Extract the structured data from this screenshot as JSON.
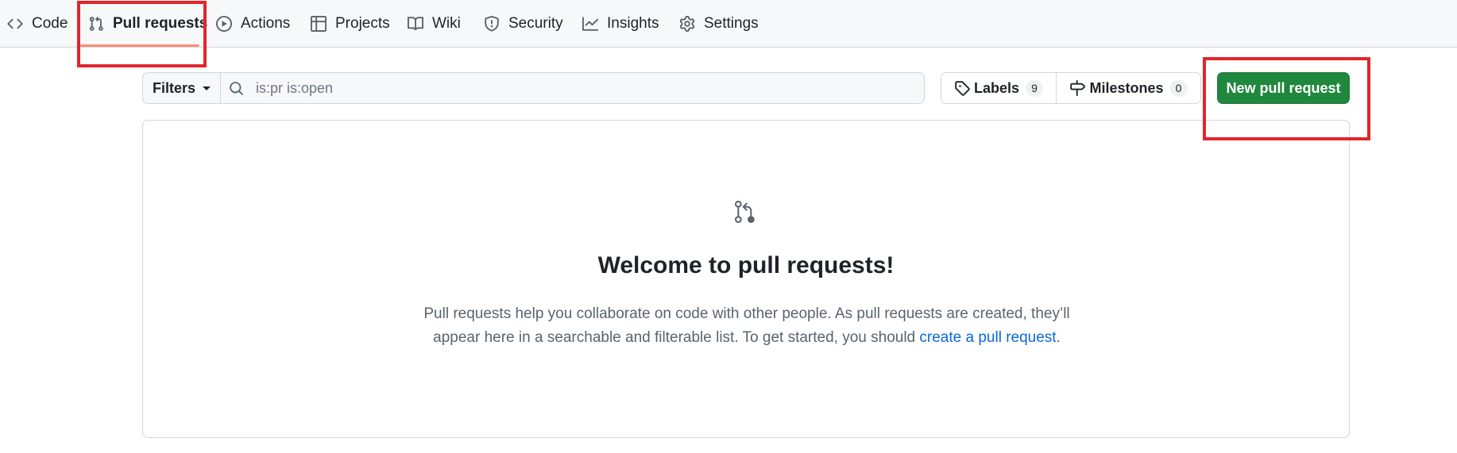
{
  "nav": {
    "items": [
      {
        "label": "Code",
        "icon": "code-icon"
      },
      {
        "label": "Pull requests",
        "icon": "git-pull-request-icon"
      },
      {
        "label": "Actions",
        "icon": "play-icon"
      },
      {
        "label": "Projects",
        "icon": "table-icon"
      },
      {
        "label": "Wiki",
        "icon": "book-icon"
      },
      {
        "label": "Security",
        "icon": "shield-icon"
      },
      {
        "label": "Insights",
        "icon": "graph-icon"
      },
      {
        "label": "Settings",
        "icon": "gear-icon"
      }
    ],
    "selected": "Pull requests",
    "underline_color": "#fd8c73"
  },
  "toolbar": {
    "filters_label": "Filters",
    "search_value": "",
    "search_placeholder": "is:pr is:open",
    "labels_label": "Labels",
    "labels_count": "9",
    "milestones_label": "Milestones",
    "milestones_count": "0",
    "new_pr_label": "New pull request"
  },
  "blankslate": {
    "icon": "git-pull-request-icon",
    "title": "Welcome to pull requests!",
    "description_line1": "Pull requests help you collaborate on code with other people. As pull requests are created, they’ll",
    "description_line2": "appear here in a searchable and filterable list. To get started, you should",
    "link_text": "create a pull request",
    "trailing": "."
  },
  "colors": {
    "primary_button": "#1f883d",
    "link": "#0969da",
    "highlight": "#e3242b"
  }
}
